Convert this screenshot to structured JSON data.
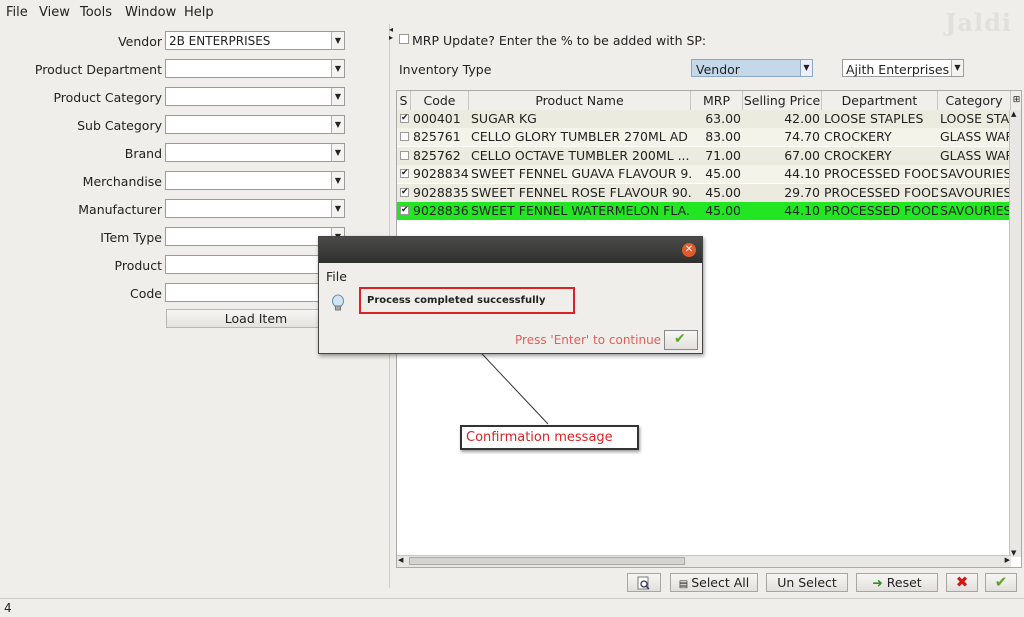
{
  "menu": {
    "file": "File",
    "view": "View",
    "tools": "Tools",
    "window": "Window",
    "help": "Help"
  },
  "logo": "Jaldi",
  "form": {
    "vendor_label": "Vendor",
    "vendor_value": "2B ENTERPRISES",
    "department_label": "Product Department",
    "category_label": "Product Category",
    "subcategory_label": "Sub Category",
    "brand_label": "Brand",
    "merchandise_label": "Merchandise",
    "manufacturer_label": "Manufacturer",
    "itemtype_label": "ITem Type",
    "product_label": "Product",
    "code_label": "Code",
    "load_button": "Load Item"
  },
  "right": {
    "mrp_update_label": "MRP Update? Enter the % to be added with SP:",
    "inventory_type_label": "Inventory Type",
    "inventory_type_value": "Vendor",
    "vendor_value": "Ajith Enterprises"
  },
  "table": {
    "headers": [
      "S",
      "Code",
      "Product Name",
      "MRP",
      "Selling Price",
      "Department",
      "Category"
    ],
    "rows": [
      {
        "checked": true,
        "code": "000401",
        "name": "SUGAR KG",
        "mrp": "63.00",
        "sp": "42.00",
        "dept": "LOOSE STAPLES",
        "cat": "LOOSE STAP"
      },
      {
        "checked": false,
        "code": "825761",
        "name": "CELLO GLORY TUMBLER 270ML AD",
        "mrp": "83.00",
        "sp": "74.70",
        "dept": "CROCKERY",
        "cat": "GLASS WARE"
      },
      {
        "checked": false,
        "code": "825762",
        "name": "CELLO OCTAVE TUMBLER 200ML ...",
        "mrp": "71.00",
        "sp": "67.00",
        "dept": "CROCKERY",
        "cat": "GLASS WARE"
      },
      {
        "checked": true,
        "code": "9028834",
        "name": "SWEET FENNEL GUAVA FLAVOUR 9...",
        "mrp": "45.00",
        "sp": "44.10",
        "dept": "PROCESSED FOOD",
        "cat": "SAVOURIES"
      },
      {
        "checked": true,
        "code": "9028835",
        "name": "SWEET FENNEL ROSE FLAVOUR 90...",
        "mrp": "45.00",
        "sp": "29.70",
        "dept": "PROCESSED FOOD",
        "cat": "SAVOURIES"
      },
      {
        "checked": true,
        "code": "9028836",
        "name": "SWEET FENNEL WATERMELON FLA...",
        "mrp": "45.00",
        "sp": "44.10",
        "dept": "PROCESSED FOOD",
        "cat": "SAVOURIES"
      }
    ]
  },
  "buttons": {
    "select_all": "Select All",
    "un_select": "Un Select",
    "reset": "Reset"
  },
  "status_text": "4",
  "dialog": {
    "menu_file": "File",
    "message": "Process completed successfully",
    "press_text": "Press 'Enter' to continue"
  },
  "callout": "Confirmation message",
  "colors": {
    "highlight_row": "#22e622",
    "row_alt": "#ecebe0",
    "callout_red": "#dd2222",
    "cancel_red": "#d01818",
    "ok_green": "#5aa52a"
  }
}
